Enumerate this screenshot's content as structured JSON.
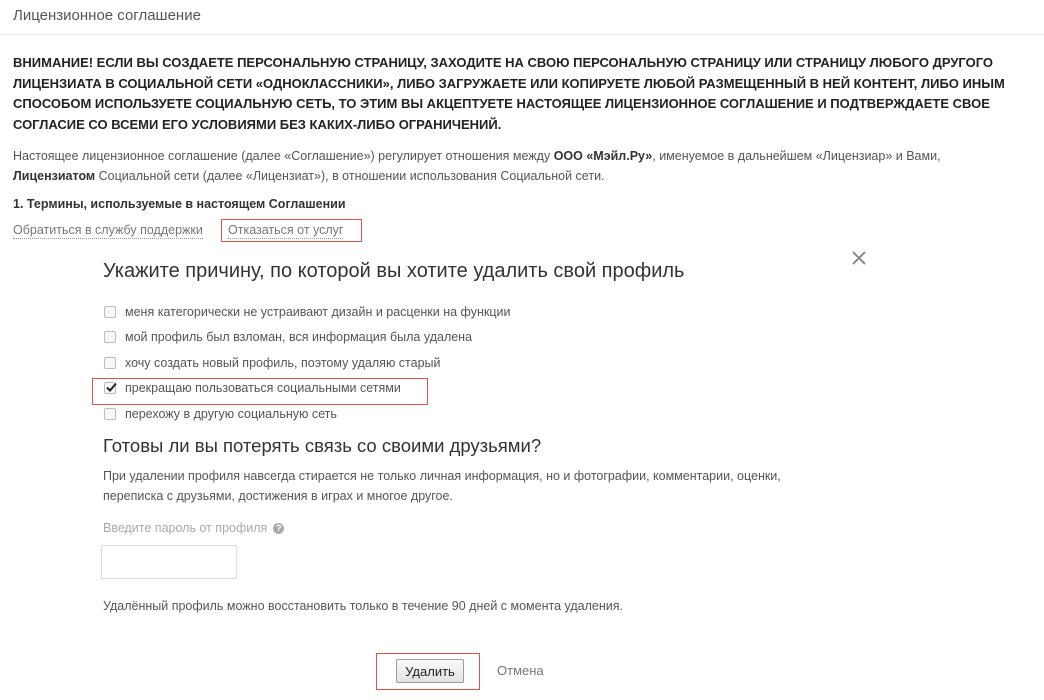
{
  "header": {
    "title": "Лицензионное соглашение"
  },
  "agreement": {
    "warning": "ВНИМАНИЕ! ЕСЛИ ВЫ СОЗДАЕТЕ ПЕРСОНАЛЬНУЮ СТРАНИЦУ, ЗАХОДИТЕ НА СВОЮ ПЕРСОНАЛЬНУЮ СТРАНИЦУ ИЛИ СТРАНИЦУ ЛЮБОГО ДРУГОГО ЛИЦЕНЗИАТА В СОЦИАЛЬНОЙ СЕТИ «ОДНОКЛАССНИКИ», ЛИБО ЗАГРУЖАЕТЕ ИЛИ КОПИРУЕТЕ ЛЮБОЙ РАЗМЕЩЕННЫЙ В НЕЙ КОНТЕНТ, ЛИБО ИНЫМ СПОСОБОМ ИСПОЛЬЗУЕТЕ СОЦИАЛЬНУЮ СЕТЬ, ТО ЭТИМ ВЫ АКЦЕПТУЕТЕ НАСТОЯЩЕЕ ЛИЦЕНЗИОННОЕ СОГЛАШЕНИЕ И ПОДТВЕРЖДАЕТЕ СВОЕ СОГЛАСИЕ СО ВСЕМИ ЕГО УСЛОВИЯМИ БЕЗ КАКИХ-ЛИБО ОГРАНИЧЕНИЙ.",
    "intro_part1": "Настоящее лицензионное соглашение (далее «Соглашение») регулирует отношения между ",
    "intro_company": "ООО «Мэйл.Ру»",
    "intro_part2": ", именуемое в дальнейшем «Лицензиар» и Вами, ",
    "intro_licensee": "Лицензиатом",
    "intro_part3": " Социальной сети (далее «Лицензиат»), в отношении использования Социальной сети.",
    "section_heading": "1. Термины, используемые в настоящем Соглашении"
  },
  "links": {
    "support": "Обратиться в службу поддержки",
    "refuse": "Отказаться от услуг"
  },
  "dialog": {
    "title": "Укажите причину, по которой вы хотите удалить свой профиль",
    "reasons": [
      {
        "label": "меня категорически не устраивают дизайн и расценки на функции",
        "checked": false
      },
      {
        "label": "мой профиль был взломан, вся информация была удалена",
        "checked": false
      },
      {
        "label": "хочу создать новый профиль, поэтому удаляю старый",
        "checked": false
      },
      {
        "label": "прекращаю пользоваться социальными сетями",
        "checked": true
      },
      {
        "label": "перехожу в другую социальную сеть",
        "checked": false
      }
    ],
    "friends_title": "Готовы ли вы потерять связь со своими друзьями?",
    "friends_desc": "При удалении профиля навсегда стирается не только личная информация, но и фотографии, комментарии, оценки, переписка с друзьями, достижения в играх и многое другое.",
    "password_label": "Введите пароль от профиля",
    "password_value": "",
    "restore_note": "Удалённый профиль можно восстановить только в течение 90 дней с момента удаления.",
    "delete_label": "Удалить",
    "cancel_label": "Отмена"
  },
  "icons": {
    "close": "close-icon",
    "help": "help-icon",
    "checkmark": "checkmark-icon"
  },
  "colors": {
    "highlight_border": "#d9534f",
    "link": "#777777",
    "text": "#333333"
  }
}
